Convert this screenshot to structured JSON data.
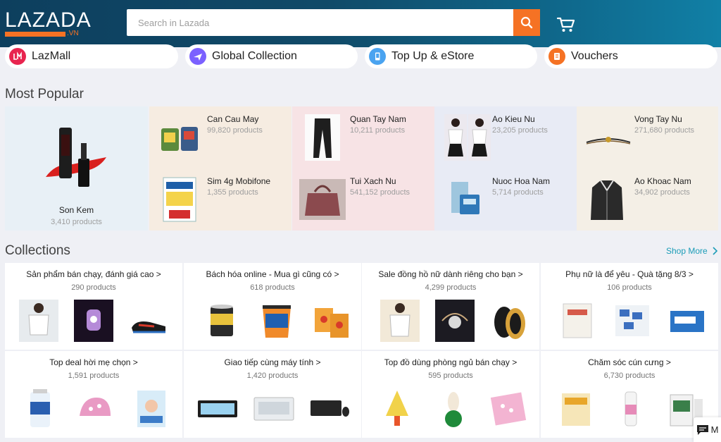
{
  "header": {
    "logo_text": "LAZADA",
    "logo_suffix": ".VN",
    "search_placeholder": "Search in Lazada",
    "search_icon": "search-icon",
    "cart_icon": "cart-icon"
  },
  "colors": {
    "brand_orange": "#f57224",
    "header_dark": "#0d3f5e",
    "link_blue": "#1a9cb7"
  },
  "nav_pills": [
    {
      "label": "LazMall",
      "icon": "lazmall-icon",
      "color": "#e8244f"
    },
    {
      "label": "Global Collection",
      "icon": "airplane-icon",
      "color": "#7b61ff"
    },
    {
      "label": "Top Up & eStore",
      "icon": "phone-icon",
      "color": "#4aa3f0"
    },
    {
      "label": "Vouchers",
      "icon": "voucher-icon",
      "color": "#f57224"
    }
  ],
  "most_popular": {
    "title": "Most Popular",
    "featured": {
      "name": "Son Kem",
      "count": "3,410 products"
    },
    "items": [
      {
        "name": "Can Cau May",
        "count": "99,820 products"
      },
      {
        "name": "Quan Tay Nam",
        "count": "10,211 products"
      },
      {
        "name": "Ao Kieu Nu",
        "count": "23,205 products"
      },
      {
        "name": "Vong Tay Nu",
        "count": "271,680 products"
      },
      {
        "name": "Sim 4g Mobifone",
        "count": "1,355 products"
      },
      {
        "name": "Tui Xach Nu",
        "count": "541,152 products"
      },
      {
        "name": "Nuoc Hoa Nam",
        "count": "5,714 products"
      },
      {
        "name": "Ao Khoac Nam",
        "count": "34,902 products"
      }
    ]
  },
  "collections": {
    "title": "Collections",
    "shop_more": "Shop More",
    "items": [
      {
        "title": "Sản phẩm bán chạy, đánh giá cao >",
        "count": "290 products"
      },
      {
        "title": "Bách hóa online - Mua gì cũng có >",
        "count": "618 products"
      },
      {
        "title": "Sale đồng hồ nữ dành riêng cho bạn >",
        "count": "4,299 products"
      },
      {
        "title": "Phụ nữ là để yêu - Quà tặng 8/3 >",
        "count": "106 products"
      },
      {
        "title": "Top deal hời mẹ chọn >",
        "count": "1,591 products"
      },
      {
        "title": "Giao tiếp cùng máy tính >",
        "count": "1,420 products"
      },
      {
        "title": "Top đồ dùng phòng ngủ bán chạy >",
        "count": "595 products"
      },
      {
        "title": "Chăm sóc cún cưng >",
        "count": "6,730 products"
      }
    ]
  },
  "chat": {
    "label": "M",
    "icon": "chat-icon"
  }
}
